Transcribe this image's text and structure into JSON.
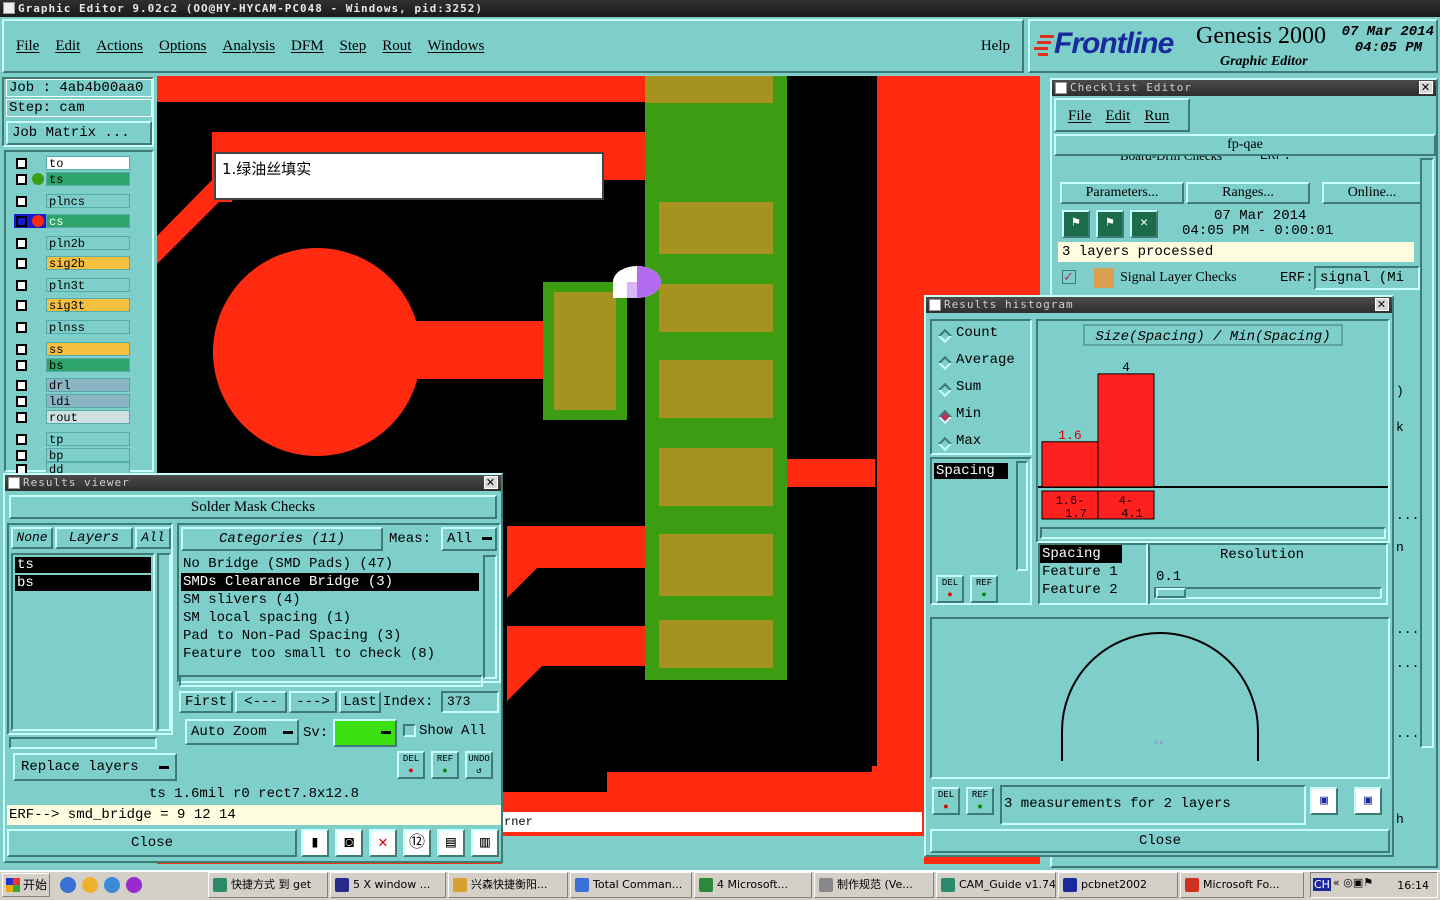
{
  "window": {
    "title": "Graphic Editor 9.02c2 (OO@HY-HYCAM-PC048 - Windows, pid:3252)"
  },
  "menu": [
    "File",
    "Edit",
    "Actions",
    "Options",
    "Analysis",
    "DFM",
    "Step",
    "Rout",
    "Windows"
  ],
  "help": "Help",
  "brand": {
    "logo": "Frontline",
    "product": "Genesis 2000",
    "subtitle": "Graphic Editor",
    "date": "07 Mar 2014",
    "time": "04:05 PM"
  },
  "job": {
    "job": "Job : 4ab4b00aa0",
    "step": "Step: cam",
    "matrix": "Job Matrix ..."
  },
  "layers": [
    "to",
    "ts",
    "plncs",
    "cs",
    "pln2b",
    "sig2b",
    "pln3t",
    "sig3t",
    "plnss",
    "ss",
    "bs",
    "drl",
    "ldi",
    "rout",
    "tp",
    "bp",
    "dd"
  ],
  "colors": {
    "copper": "#ff2a10",
    "mask": "#3b9e12",
    "pad": "#a6921e",
    "board": "#000000",
    "panel": "#7ececa",
    "selected": "#000000"
  },
  "annotation": "1.绿油丝填实",
  "results": {
    "title": "Results viewer",
    "header": "Solder Mask Checks",
    "none": "None",
    "layers_label": "Layers",
    "all": "All",
    "categories_label": "Categories (11)",
    "meas_label": "Meas:",
    "meas_value": "All",
    "layer_list": [
      "ts",
      "bs"
    ],
    "categories": [
      "No Bridge (SMD Pads) (47)",
      "SMDs Clearance Bridge (3)",
      "SM slivers (4)",
      "SM local spacing (1)",
      "Pad to Non-Pad Spacing (3)",
      "Feature too small to check (8)"
    ],
    "first": "First",
    "prev": "<---",
    "next": "--->",
    "last": "Last",
    "index_label": "Index:",
    "index_value": "373",
    "autozoom": "Auto Zoom",
    "sv": "Sv:",
    "showall": "Show All",
    "replace": "Replace layers",
    "del": "DEL",
    "ref": "REF",
    "undo": "UNDO",
    "status": "ts 1.6mil  r0  rect7.8x12.8",
    "erf": "ERF--> smd_bridge = 9 12 14",
    "close": "Close"
  },
  "checklist": {
    "title": "Checklist Editor",
    "menu": [
      "File",
      "Edit",
      "Run"
    ],
    "name": "fp-qae",
    "row0": "Board-Drill Checks",
    "erf": "ERF:",
    "row0_val": "...",
    "params": "Parameters...",
    "ranges": "Ranges...",
    "online": "Online...",
    "date": "07 Mar 2014",
    "timer": "04:05 PM - 0:00:01",
    "processed": "3 layers processed",
    "signal": "Signal Layer Checks",
    "signal_val": "signal (Mi",
    "side": [
      ")",
      "k",
      "...",
      "n",
      "...",
      "...",
      "...",
      "h"
    ]
  },
  "histogram": {
    "title": "Results histogram",
    "modes": [
      "Count",
      "Average",
      "Sum",
      "Min",
      "Max"
    ],
    "selected_mode": "Min",
    "list": [
      "Spacing"
    ],
    "chart_title": "Size(Spacing) / Min(Spacing)",
    "resolution_label": "Resolution",
    "resolution_value": "0.1",
    "attr_list": [
      "Spacing",
      "Feature 1",
      "Feature 2"
    ],
    "summary": "3 measurements for 2 layers",
    "close": "Close",
    "del": "DEL",
    "ref": "REF"
  },
  "chart_data": {
    "type": "bar",
    "title": "Size(Spacing) / Min(Spacing)",
    "categories": [
      "1.6-1.7",
      "4-4.1"
    ],
    "values": [
      1.6,
      4
    ],
    "value_labels": [
      "1.6",
      "4"
    ],
    "ylim": [
      0,
      4.5
    ]
  },
  "statusbar": {
    "fragment": "rner"
  },
  "taskbar": {
    "start": "开始",
    "items": [
      "快捷方式 到 get",
      "5 X window ...",
      "兴森快捷衡阳...",
      "Total Comman...",
      "4 Microsoft...",
      "制作规范 (Ve...",
      "CAM_Guide v1.74",
      "pcbnet2002",
      "Microsoft Fo..."
    ],
    "tray_time": "16:14",
    "tray_lang": "CH"
  }
}
